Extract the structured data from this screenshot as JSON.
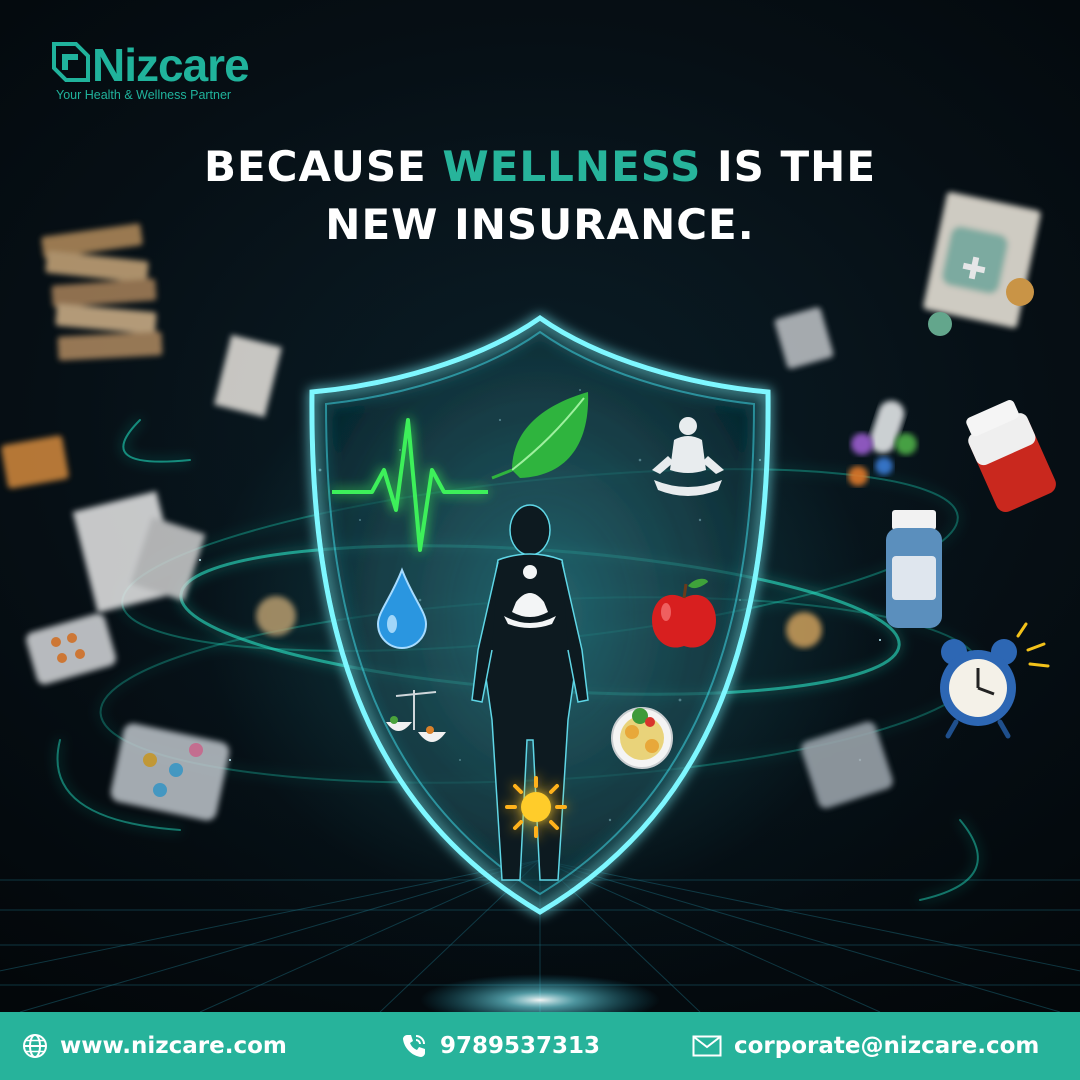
{
  "brand": {
    "name": "Nizcare",
    "tagline": "Your Health & Wellness Partner",
    "color": "#20b39c"
  },
  "headline": {
    "part1": "BECAUSE",
    "accent": "WELLNESS",
    "part2": "IS THE",
    "line2": "NEW INSURANCE.",
    "accent_color": "#27b49b"
  },
  "illustration": {
    "icons": [
      "heartbeat-icon",
      "leaf-icon",
      "meditation-icon",
      "water-drop-icon",
      "apple-icon",
      "balance-scale-icon",
      "food-plate-icon",
      "sun-icon",
      "alarm-clock-icon",
      "medicine-bottle-icon",
      "pills-icon",
      "documents-icon"
    ]
  },
  "footer": {
    "background": "#27b39b",
    "website": "www.nizcare.com",
    "phone": "9789537313",
    "email": "corporate@nizcare.com"
  }
}
